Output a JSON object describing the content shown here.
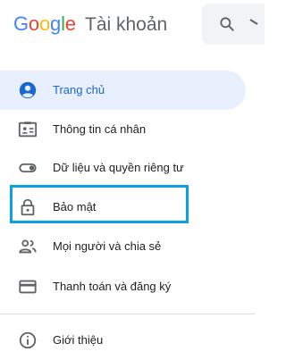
{
  "header": {
    "logo_letters": [
      "G",
      "o",
      "o",
      "g",
      "l",
      "e"
    ],
    "logo_colors": [
      "#4285F4",
      "#EA4335",
      "#FBBC05",
      "#4285F4",
      "#34A853",
      "#EA4335"
    ],
    "product_name": "Tài khoản"
  },
  "search": {
    "icon": "search-icon"
  },
  "nav": {
    "items": [
      {
        "id": "home",
        "label": "Trang chủ",
        "icon": "account-circle-icon",
        "active": true
      },
      {
        "id": "personal-info",
        "label": "Thông tin cá nhân",
        "icon": "id-card-icon",
        "active": false
      },
      {
        "id": "data-privacy",
        "label": "Dữ liệu và quyền riêng tư",
        "icon": "toggle-icon",
        "active": false
      },
      {
        "id": "security",
        "label": "Bảo mật",
        "icon": "lock-icon",
        "active": false
      },
      {
        "id": "people-sharing",
        "label": "Mọi người và chia sẻ",
        "icon": "people-icon",
        "active": false
      },
      {
        "id": "payments",
        "label": "Thanh toán và đăng ký",
        "icon": "credit-card-icon",
        "active": false
      },
      {
        "id": "about",
        "label": "Giới thiệu",
        "icon": "info-icon",
        "active": false
      }
    ]
  },
  "colors": {
    "accent": "#1967d2",
    "active_bg": "#e8f0fe",
    "icon": "#5f6368",
    "highlight_border": "#0aa1e6"
  }
}
